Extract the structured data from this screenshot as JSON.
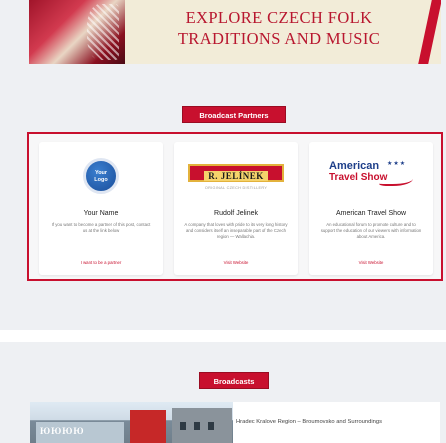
{
  "banner": {
    "line1": "EXPLORE CZECH FOLK",
    "line2": "TRADITIONS AND MUSIC",
    "image": "folk-costume-photo"
  },
  "partners": {
    "tag_label": "Broadcast Partners",
    "cards": [
      {
        "logo_text_1": "Your",
        "logo_text_2": "Logo",
        "name": "Your Name",
        "description": "If you want to become a partner of this post, contact us at the link below",
        "link": "I want to be a partner"
      },
      {
        "logo_text": "R. JELÍNEK",
        "logo_subtitle": "ORIGINAL CZECH DISTILLERY",
        "name": "Rudolf Jelinek",
        "description": "A company that loves with pride to its very long history and considers itself an inseparable part of the Czech region — Wallachia.",
        "link": "Visit Website"
      },
      {
        "logo_text_1": "American",
        "logo_text_2": "Travel Show",
        "name": "American Travel Show",
        "description": "An educational forum to promote culture and to support the education of our viewers with information about America.",
        "link": "Visit Website"
      }
    ]
  },
  "broadcasts": {
    "tag_label": "Broadcasts",
    "items": [
      {
        "title": "Hradec Kralove Region – Broumovsko and Surroundings",
        "photo_text": "ЮЮЮЮ"
      }
    ]
  },
  "colors": {
    "accent": "#c8102e",
    "background": "#eef0f3",
    "navy": "#1e3f8a"
  }
}
